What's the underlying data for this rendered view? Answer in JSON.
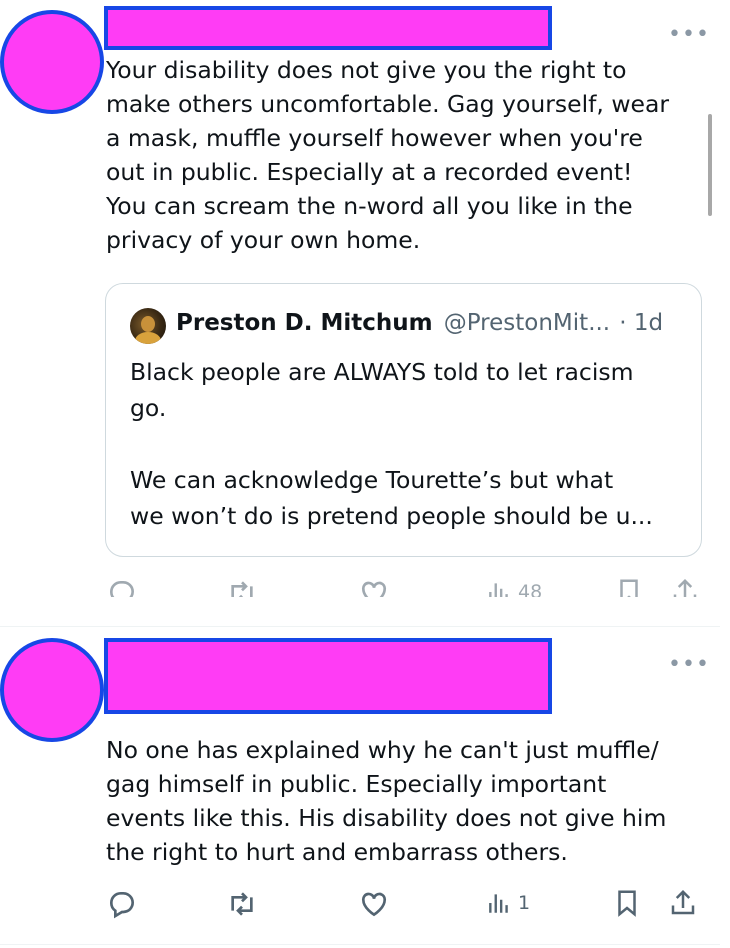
{
  "tweet1": {
    "more_label": "•••",
    "text": "Your disability does not give you the right to\nmake others uncomfortable. Gag yourself, wear\na mask, muffle yourself however when you're\nout in public. Especially at a recorded event!\nYou can scream the n-word all you like in the\nprivacy of your own home.",
    "quote": {
      "name": "Preston D. Mitchum",
      "handle": "@PrestonMit...",
      "time": "· 1d",
      "text": "Black people are ALWAYS told to let racism\ngo.\n\nWe can acknowledge Tourette’s but what\nwe won’t do is pretend people should be u..."
    },
    "views": "48"
  },
  "tweet2": {
    "more_label": "•••",
    "text": "No one has explained why he can't just muffle/\ngag himself in public. Especially important\nevents like this. His disability does not give him\nthe right to hurt and embarrass others.",
    "views": "1"
  },
  "colors": {
    "redaction_fill": "#ff3cf5",
    "redaction_border": "#1747e6",
    "icon_gray": "#536471"
  },
  "icons": [
    "reply-icon",
    "retweet-icon",
    "like-icon",
    "views-icon",
    "bookmark-icon",
    "share-icon",
    "more-icon"
  ]
}
